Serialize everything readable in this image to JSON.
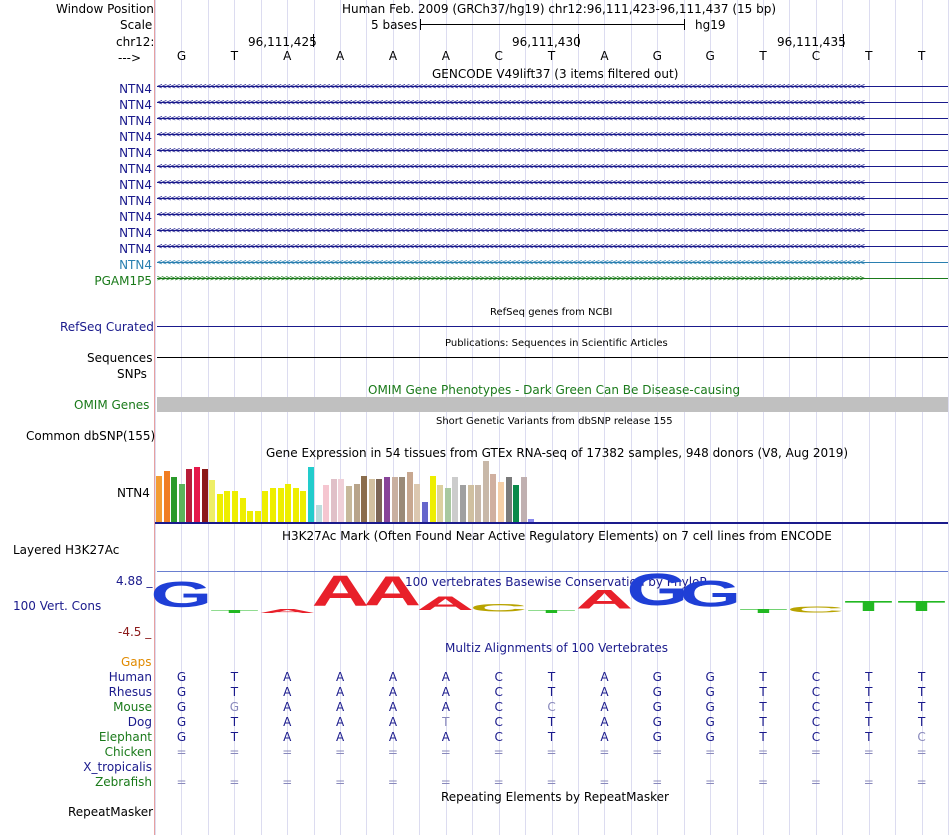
{
  "header": {
    "window_position_label": "Window Position",
    "window_position_value": "Human Feb. 2009 (GRCh37/hg19)   chr12:96,111,423-96,111,437 (15 bp)",
    "scale_label": "Scale",
    "scale_value": "5 bases",
    "scale_assembly": "hg19",
    "chrom_label": "chr12:",
    "strand_label": "--->",
    "coord_ticks": [
      "96,111,425",
      "96,111,430",
      "96,111,435"
    ]
  },
  "sequence": [
    "G",
    "T",
    "A",
    "A",
    "A",
    "A",
    "C",
    "T",
    "A",
    "G",
    "G",
    "T",
    "C",
    "T",
    "T"
  ],
  "gencode": {
    "title": "GENCODE V49lift37 (3 items filtered out)",
    "items": [
      {
        "label": "NTN4",
        "color": "#1a1a8c",
        "strand": "<"
      },
      {
        "label": "NTN4",
        "color": "#1a1a8c",
        "strand": "<"
      },
      {
        "label": "NTN4",
        "color": "#1a1a8c",
        "strand": "<"
      },
      {
        "label": "NTN4",
        "color": "#1a1a8c",
        "strand": "<"
      },
      {
        "label": "NTN4",
        "color": "#1a1a8c",
        "strand": "<"
      },
      {
        "label": "NTN4",
        "color": "#1a1a8c",
        "strand": "<"
      },
      {
        "label": "NTN4",
        "color": "#1a1a8c",
        "strand": "<"
      },
      {
        "label": "NTN4",
        "color": "#1a1a8c",
        "strand": "<"
      },
      {
        "label": "NTN4",
        "color": "#1a1a8c",
        "strand": "<"
      },
      {
        "label": "NTN4",
        "color": "#1a1a8c",
        "strand": "<"
      },
      {
        "label": "NTN4",
        "color": "#1a1a8c",
        "strand": "<"
      },
      {
        "label": "NTN4",
        "color": "#2a7fb0",
        "strand": "<"
      },
      {
        "label": "PGAM1P5",
        "color": "#1a7a1a",
        "strand": ">"
      }
    ]
  },
  "refseq": {
    "title": "RefSeq genes from NCBI",
    "label": "RefSeq Curated"
  },
  "publications": {
    "title": "Publications: Sequences in Scientific Articles",
    "label": "Sequences"
  },
  "snps_label": "SNPs",
  "omim": {
    "title": "OMIM Gene Phenotypes - Dark Green Can Be Disease-causing",
    "label": "OMIM Genes"
  },
  "dbsnp": {
    "title": "Short Genetic Variants from dbSNP release 155",
    "label": "Common dbSNP(155)"
  },
  "gtex": {
    "title": "Gene Expression in 54 tissues from GTEx RNA-seq of 17382 samples, 948 donors (V8, Aug 2019)",
    "label": "NTN4",
    "bars": [
      {
        "v": 0.75,
        "c": "#f39c33"
      },
      {
        "v": 0.82,
        "c": "#f07d22"
      },
      {
        "v": 0.72,
        "c": "#2b9a2b"
      },
      {
        "v": 0.62,
        "c": "#5bb55b"
      },
      {
        "v": 0.86,
        "c": "#b81d3a"
      },
      {
        "v": 0.88,
        "c": "#e6194b"
      },
      {
        "v": 0.85,
        "c": "#8b1a1a"
      },
      {
        "v": 0.68,
        "c": "#eeee66"
      },
      {
        "v": 0.45,
        "c": "#eeee00"
      },
      {
        "v": 0.5,
        "c": "#eeee00"
      },
      {
        "v": 0.5,
        "c": "#eeee00"
      },
      {
        "v": 0.38,
        "c": "#eeee00"
      },
      {
        "v": 0.18,
        "c": "#eeee00"
      },
      {
        "v": 0.18,
        "c": "#eeee00"
      },
      {
        "v": 0.5,
        "c": "#eeee00"
      },
      {
        "v": 0.55,
        "c": "#eeee00"
      },
      {
        "v": 0.55,
        "c": "#eeee00"
      },
      {
        "v": 0.62,
        "c": "#eeee00"
      },
      {
        "v": 0.55,
        "c": "#eeee00"
      },
      {
        "v": 0.5,
        "c": "#eeee00"
      },
      {
        "v": 0.88,
        "c": "#22cccc"
      },
      {
        "v": 0.28,
        "c": "#bbdddd"
      },
      {
        "v": 0.6,
        "c": "#f5c6d0"
      },
      {
        "v": 0.7,
        "c": "#e0c0c8"
      },
      {
        "v": 0.7,
        "c": "#f0d0d8"
      },
      {
        "v": 0.58,
        "c": "#c7b89a"
      },
      {
        "v": 0.62,
        "c": "#b8a48a"
      },
      {
        "v": 0.75,
        "c": "#8b6d4d"
      },
      {
        "v": 0.7,
        "c": "#d3c1a0"
      },
      {
        "v": 0.7,
        "c": "#7d6655"
      },
      {
        "v": 0.72,
        "c": "#884499"
      },
      {
        "v": 0.72,
        "c": "#c9b0a0"
      },
      {
        "v": 0.72,
        "c": "#9a8a78"
      },
      {
        "v": 0.8,
        "c": "#c8a890"
      },
      {
        "v": 0.62,
        "c": "#dcc8b0"
      },
      {
        "v": 0.32,
        "c": "#6666cc"
      },
      {
        "v": 0.75,
        "c": "#eeee00"
      },
      {
        "v": 0.6,
        "c": "#dcd0a0"
      },
      {
        "v": 0.55,
        "c": "#a8c8a0"
      },
      {
        "v": 0.72,
        "c": "#cccccc"
      },
      {
        "v": 0.6,
        "c": "#a0a0a0"
      },
      {
        "v": 0.6,
        "c": "#d0c0a0"
      },
      {
        "v": 0.6,
        "c": "#c8b8a8"
      },
      {
        "v": 0.98,
        "c": "#c8b8a8"
      },
      {
        "v": 0.78,
        "c": "#d0b0a0"
      },
      {
        "v": 0.65,
        "c": "#f5d0a8"
      },
      {
        "v": 0.72,
        "c": "#7a7a7a"
      },
      {
        "v": 0.6,
        "c": "#0a8a4a"
      },
      {
        "v": 0.72,
        "c": "#c0b0b0"
      },
      {
        "v": 0.05,
        "c": "#8888ee"
      }
    ]
  },
  "h3k27ac": {
    "title": "H3K27Ac Mark (Often Found Near Active Regulatory Elements) on 7 cell lines from ENCODE",
    "label": "Layered H3K27Ac"
  },
  "phylop": {
    "title": "100 vertebrates Basewise Conservation by PhyloP",
    "label": "100 Vert. Cons",
    "ymax": "4.88 _",
    "ymin": "-4.5 _",
    "scores": [
      3.8,
      -0.2,
      0.6,
      4.6,
      4.4,
      2.0,
      1.2,
      0.3,
      2.8,
      4.8,
      3.9,
      0.6,
      0.9,
      1.6,
      1.6
    ],
    "colors": {
      "A": "#e8202a",
      "C": "#b8a300",
      "G": "#1f3fd6",
      "T": "#22b822"
    }
  },
  "multiz": {
    "title": "Multiz Alignments of 100 Vertebrates",
    "gaps_label": "Gaps",
    "species": [
      {
        "name": "Human",
        "color": "#1a1a8c",
        "seq": [
          "G",
          "T",
          "A",
          "A",
          "A",
          "A",
          "C",
          "T",
          "A",
          "G",
          "G",
          "T",
          "C",
          "T",
          "T"
        ],
        "dim": []
      },
      {
        "name": "Rhesus",
        "color": "#1a1a8c",
        "seq": [
          "G",
          "T",
          "A",
          "A",
          "A",
          "A",
          "C",
          "T",
          "A",
          "G",
          "G",
          "T",
          "C",
          "T",
          "T"
        ],
        "dim": []
      },
      {
        "name": "Mouse",
        "color": "#1a7a1a",
        "seq": [
          "G",
          "G",
          "A",
          "A",
          "A",
          "A",
          "C",
          "C",
          "A",
          "G",
          "G",
          "T",
          "C",
          "T",
          "T"
        ],
        "dim": [
          1,
          7
        ]
      },
      {
        "name": "Dog",
        "color": "#1a1a8c",
        "seq": [
          "G",
          "T",
          "A",
          "A",
          "A",
          "T",
          "C",
          "T",
          "A",
          "G",
          "G",
          "T",
          "C",
          "T",
          "T"
        ],
        "dim": [
          5
        ]
      },
      {
        "name": "Elephant",
        "color": "#1a7a1a",
        "seq": [
          "G",
          "T",
          "A",
          "A",
          "A",
          "A",
          "C",
          "T",
          "A",
          "G",
          "G",
          "T",
          "C",
          "T",
          "C"
        ],
        "dim": [
          14
        ]
      },
      {
        "name": "Chicken",
        "color": "#1a7a1a",
        "seq": [
          "=",
          "=",
          "=",
          "=",
          "=",
          "=",
          "=",
          "=",
          "=",
          "=",
          "=",
          "=",
          "=",
          "=",
          "="
        ],
        "dim": []
      },
      {
        "name": "X_tropicalis",
        "color": "#1a1a8c",
        "seq": [],
        "dim": []
      },
      {
        "name": "Zebrafish",
        "color": "#1a7a1a",
        "seq": [
          "=",
          "=",
          "=",
          "=",
          "=",
          "=",
          "=",
          "=",
          "=",
          "=",
          "=",
          "=",
          "=",
          "=",
          "="
        ],
        "dim": []
      }
    ]
  },
  "repeatmasker": {
    "title": "Repeating Elements by RepeatMasker",
    "label": "RepeatMasker"
  },
  "colors": {
    "navy": "#1a1a8c",
    "green": "#1a7a1a",
    "omim_bar": "#c0c0c0",
    "gaps": "#e08a00",
    "ymax": "#1a1a8c",
    "ymin": "#8b1a1a"
  }
}
